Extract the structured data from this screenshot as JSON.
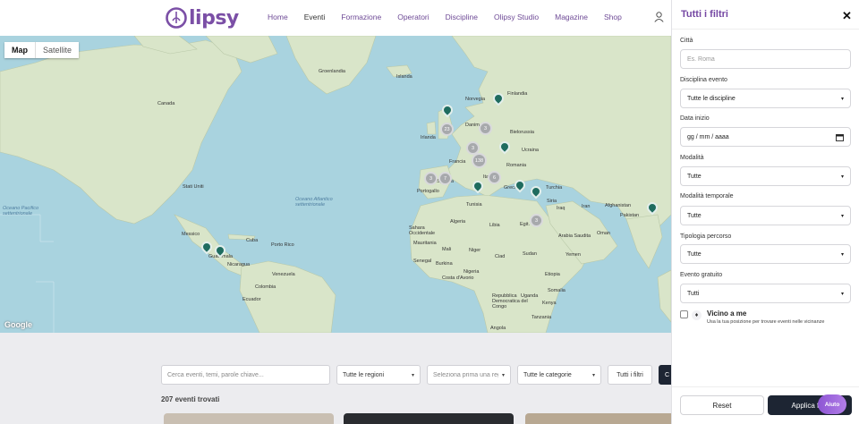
{
  "header": {
    "logo_text": "lipsy",
    "nav": [
      "Home",
      "Eventi",
      "Formazione",
      "Operatori",
      "Discipline",
      "Olipsy Studio",
      "Magazine",
      "Shop"
    ],
    "active_nav": "Eventi"
  },
  "map": {
    "type_map": "Map",
    "type_satellite": "Satellite",
    "attribution": "Google",
    "labels": {
      "groenlandia": "Groenlandia",
      "islanda": "Islanda",
      "canada": "Canada",
      "stati_uniti": "Stati Uniti",
      "messico": "Messico",
      "cuba": "Cuba",
      "porto_rico": "Porto Rico",
      "guatemala": "Guatemala",
      "nicaragua": "Nicaragua",
      "venezuela": "Venezuela",
      "colombia": "Colombia",
      "ecuador": "Ecuador",
      "norvegia": "Norvegia",
      "finlandia": "Finlandia",
      "irlanda": "Irlanda",
      "danimarca": "Danim.",
      "bielorussia": "Bielorussia",
      "ucraina": "Ucraina",
      "francia": "Francia",
      "romania": "Romania",
      "italia": "Italia",
      "spagna": "Spagna",
      "portogallo": "Portogallo",
      "grecia": "Grecia",
      "turchia": "Turchia",
      "siria": "Siria",
      "iraq": "Iraq",
      "iran": "Iran",
      "afghanistan": "Afghanistan",
      "pakistan": "Pakistan",
      "tunisia": "Tunisia",
      "algeria": "Algeria",
      "libia": "Libia",
      "egitto": "Egit.",
      "arabia_saudita": "Arabia Saudita",
      "oman": "Oman",
      "yemen": "Yemen",
      "mali": "Mali",
      "niger": "Niger",
      "ciad": "Ciad",
      "sudan": "Sudan",
      "etiopia": "Etiopia",
      "nigeria": "Nigeria",
      "kenya": "Kenya",
      "tanzania": "Tanzania",
      "senegal": "Senegal",
      "mauritania": "Mauritania",
      "sahara": "Sahara Occidentale",
      "rdc": "Repubblica Democratica del Congo",
      "angola": "Angola",
      "oceano_atlantico": "Oceano Atlantico settentrionale",
      "oceano_pacifico": "Oceano Pacifico settentrionale",
      "uganda": "Uganda",
      "somalia": "Somalia",
      "burkina": "Burkina",
      "costa": "Costa d'Avorio"
    },
    "clusters": [
      "23",
      "3",
      "3",
      "138",
      "6",
      "3",
      "7",
      "3"
    ]
  },
  "search": {
    "placeholder": "Cerca eventi, temi, parole chiave...",
    "region": "Tutte le regioni",
    "province_placeholder": "Seleziona prima una regione",
    "category": "Tutte le categorie",
    "all_filters": "Tutti i filtri",
    "extra_btn": "C"
  },
  "results": {
    "count_text": "207 eventi trovati"
  },
  "panel": {
    "title": "Tutti i filtri",
    "close": "✕",
    "city_label": "Città",
    "city_placeholder": "Es. Roma",
    "discipline_label": "Disciplina evento",
    "discipline_value": "Tutte le discipline",
    "date_label": "Data inizio",
    "date_value": "gg / mm / aaaa",
    "mode_label": "Modalità",
    "mode_value": "Tutte",
    "time_mode_label": "Modalità temporale",
    "time_mode_value": "Tutte",
    "path_label": "Tipologia percorso",
    "path_value": "Tutte",
    "free_label": "Evento gratuito",
    "free_value": "Tutti",
    "near_title": "Vicino a me",
    "near_sub": "Usa la tua posizione per trovare eventi nelle vicinanze",
    "reset": "Reset",
    "apply": "Applica filtri",
    "help": "Aiuto"
  },
  "colors": {
    "brand": "#7548a3",
    "pin": "#1f6c5f",
    "dark_button": "#1d2533",
    "water": "#a9d3df",
    "land": "#d7e3c5"
  }
}
